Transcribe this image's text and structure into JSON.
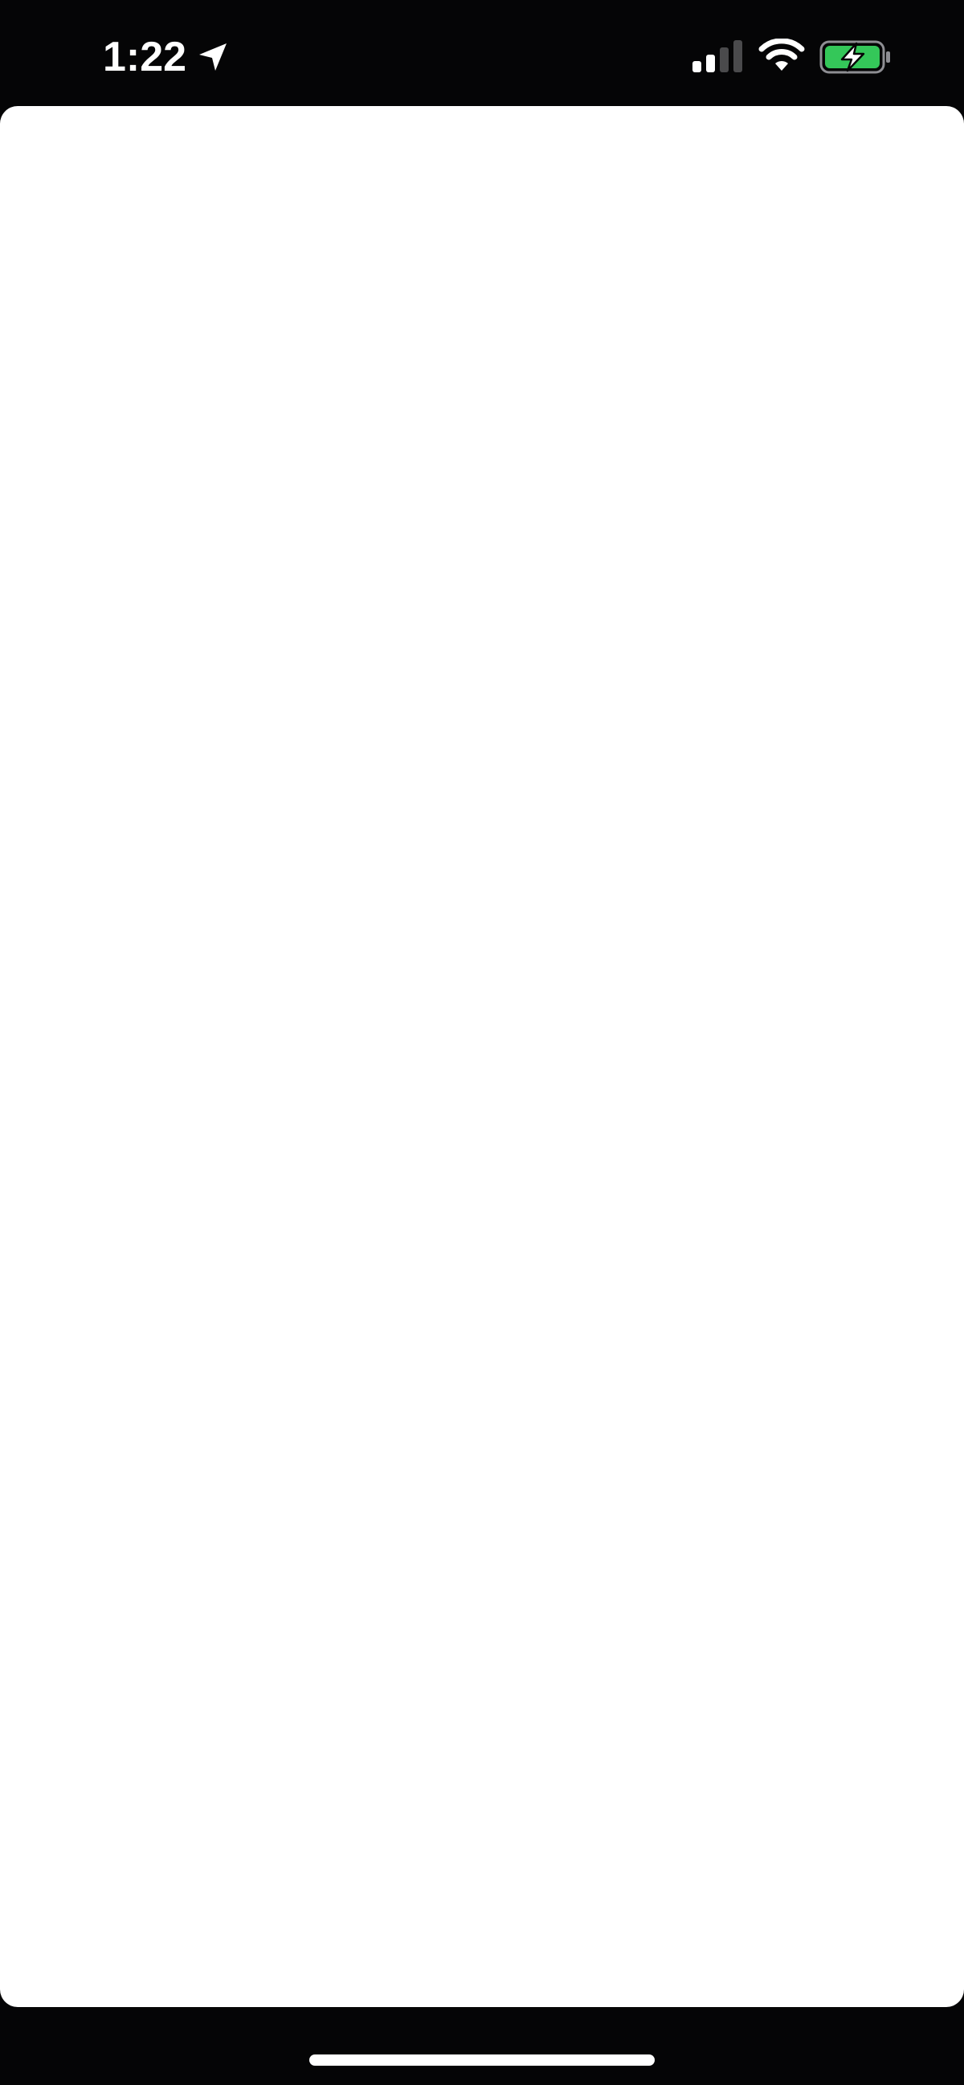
{
  "status_bar": {
    "time": "1:22",
    "location_icon": "location-arrow-icon",
    "signal_icon": "cellular-signal-icon",
    "signal_bars_active": 2,
    "signal_bars_total": 4,
    "wifi_icon": "wifi-icon",
    "battery_icon": "battery-charging-icon",
    "battery_color": "#34c759",
    "charging": true
  },
  "colors": {
    "background": "#050506",
    "sheet": "#ffffff",
    "home_indicator": "#ffffff"
  }
}
